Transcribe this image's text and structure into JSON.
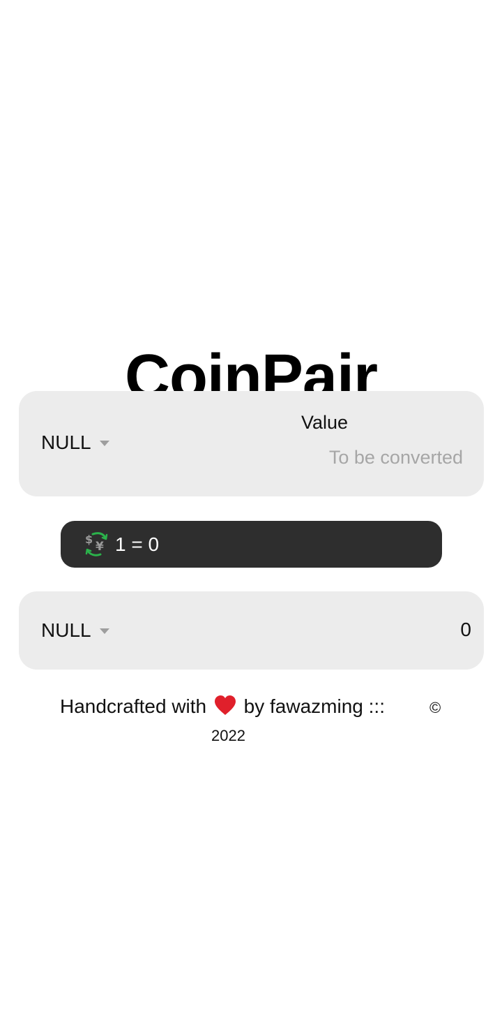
{
  "app": {
    "title": "CoinPair"
  },
  "from_card": {
    "currency": "NULL",
    "value_label": "Value",
    "value_placeholder": "To be converted",
    "value": ""
  },
  "rate": {
    "icon": "currency-exchange-icon",
    "text": "1 = 0"
  },
  "to_card": {
    "currency": "NULL",
    "result": "0"
  },
  "footer": {
    "prefix": "Handcrafted with",
    "heart_icon": "heart-icon",
    "suffix": "by fawazming :::",
    "copyright": "©",
    "year": "2022"
  },
  "colors": {
    "card_background": "#ececec",
    "rate_background": "#2e2e2e",
    "heart": "#e0202b",
    "placeholder": "#a6a6a6"
  }
}
